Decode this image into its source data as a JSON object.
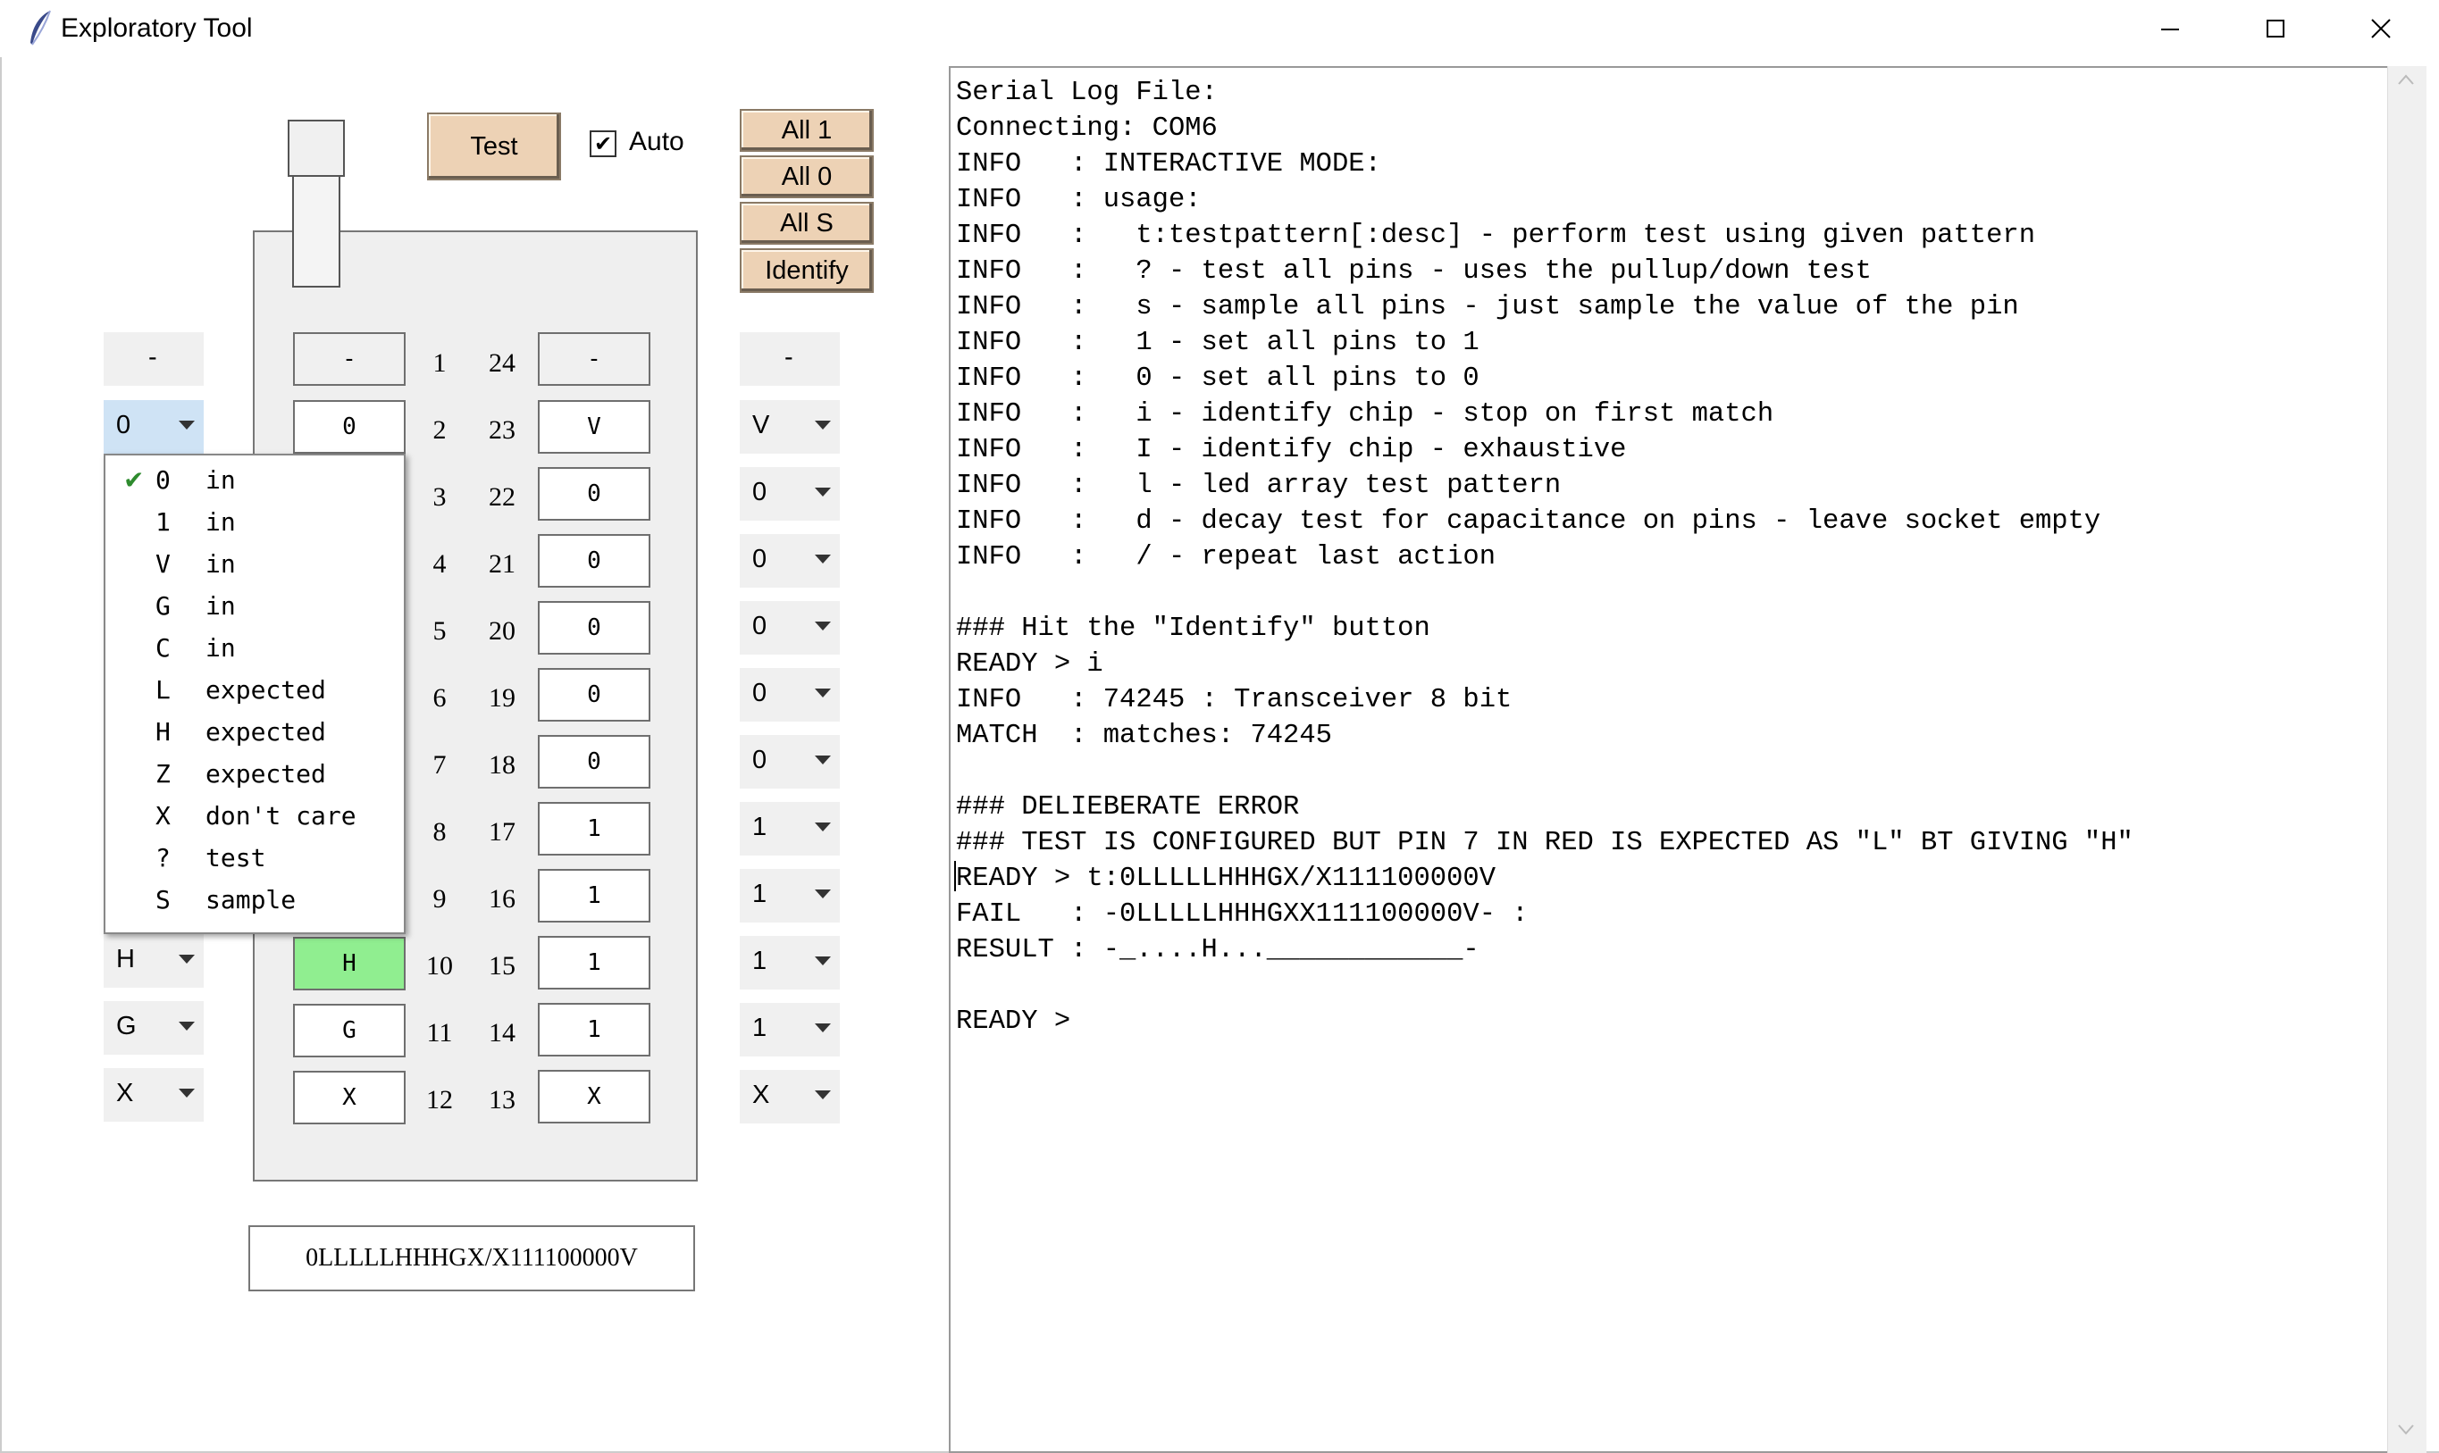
{
  "window": {
    "title": "Exploratory Tool"
  },
  "controls": {
    "test_label": "Test",
    "auto_label": "Auto",
    "auto_checked": true,
    "all1_label": "All 1",
    "all0_label": "All 0",
    "alls_label": "All S",
    "identify_label": "Identify"
  },
  "pins": {
    "left": [
      {
        "num": "1",
        "box": "-",
        "combo": "-"
      },
      {
        "num": "2",
        "box": "0",
        "combo": "0"
      },
      {
        "num": "3",
        "box": "",
        "combo": ""
      },
      {
        "num": "4",
        "box": "",
        "combo": ""
      },
      {
        "num": "5",
        "box": "",
        "combo": ""
      },
      {
        "num": "6",
        "box": "",
        "combo": ""
      },
      {
        "num": "7",
        "box": "",
        "combo": ""
      },
      {
        "num": "8",
        "box": "",
        "combo": ""
      },
      {
        "num": "9",
        "box": "",
        "combo": ""
      },
      {
        "num": "10",
        "box": "H",
        "combo": "H"
      },
      {
        "num": "11",
        "box": "G",
        "combo": "G"
      },
      {
        "num": "12",
        "box": "X",
        "combo": "X"
      }
    ],
    "right": [
      {
        "num": "24",
        "box": "-",
        "combo": "-"
      },
      {
        "num": "23",
        "box": "V",
        "combo": "V"
      },
      {
        "num": "22",
        "box": "0",
        "combo": "0"
      },
      {
        "num": "21",
        "box": "0",
        "combo": "0"
      },
      {
        "num": "20",
        "box": "0",
        "combo": "0"
      },
      {
        "num": "19",
        "box": "0",
        "combo": "0"
      },
      {
        "num": "18",
        "box": "0",
        "combo": "0"
      },
      {
        "num": "17",
        "box": "1",
        "combo": "1"
      },
      {
        "num": "16",
        "box": "1",
        "combo": "1"
      },
      {
        "num": "15",
        "box": "1",
        "combo": "1"
      },
      {
        "num": "14",
        "box": "1",
        "combo": "1"
      },
      {
        "num": "13",
        "box": "X",
        "combo": "X"
      }
    ]
  },
  "menu": {
    "items": [
      {
        "key": "0",
        "desc": "in",
        "checked": true
      },
      {
        "key": "1",
        "desc": "in",
        "checked": false
      },
      {
        "key": "V",
        "desc": "in",
        "checked": false
      },
      {
        "key": "G",
        "desc": "in",
        "checked": false
      },
      {
        "key": "C",
        "desc": "in",
        "checked": false
      },
      {
        "key": "L",
        "desc": "expected",
        "checked": false
      },
      {
        "key": "H",
        "desc": "expected",
        "checked": false
      },
      {
        "key": "Z",
        "desc": "expected",
        "checked": false
      },
      {
        "key": "X",
        "desc": "don't care",
        "checked": false
      },
      {
        "key": "?",
        "desc": "test",
        "checked": false
      },
      {
        "key": "S",
        "desc": "sample",
        "checked": false
      }
    ]
  },
  "pattern": "0LLLLLHHHGX/X111100000V",
  "log": "Serial Log File:\nConnecting: COM6\nINFO   : INTERACTIVE MODE:\nINFO   : usage:\nINFO   :   t:testpattern[:desc] - perform test using given pattern\nINFO   :   ? - test all pins - uses the pullup/down test\nINFO   :   s - sample all pins - just sample the value of the pin\nINFO   :   1 - set all pins to 1\nINFO   :   0 - set all pins to 0\nINFO   :   i - identify chip - stop on first match\nINFO   :   I - identify chip - exhaustive\nINFO   :   l - led array test pattern\nINFO   :   d - decay test for capacitance on pins - leave socket empty\nINFO   :   / - repeat last action\n\n### Hit the \"Identify\" button\nREADY > i\nINFO   : 74245 : Transceiver 8 bit\nMATCH  : matches: 74245\n\n### DELIEBERATE ERROR\n### TEST IS CONFIGURED BUT PIN 7 IN RED IS EXPECTED AS \"L\" BT GIVING \"H\"\nREADY > t:0LLLLLHHHGX/X111100000V\nFAIL   : -0LLLLLHHHGXX111100000V- :\nRESULT : -_....H...____________-\n\nREADY >"
}
